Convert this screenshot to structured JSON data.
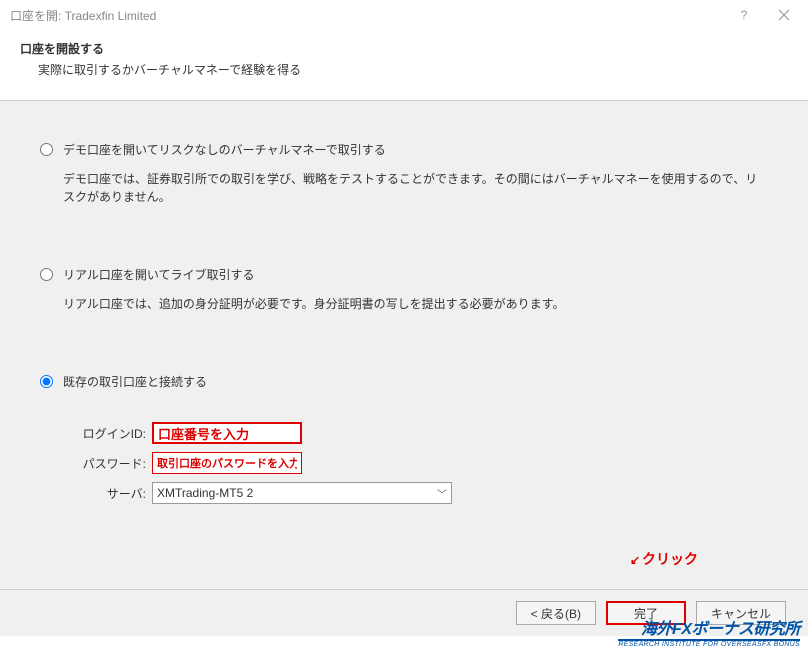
{
  "window": {
    "title": "口座を開: Tradexfin Limited"
  },
  "header": {
    "title": "口座を開設する",
    "subtitle": "実際に取引するかバーチャルマネーで経験を得る"
  },
  "options": {
    "demo": {
      "title": "デモ口座を開いてリスクなしのバーチャルマネーで取引する",
      "desc": "デモ口座では、証券取引所での取引を学び、戦略をテストすることができます。その間にはバーチャルマネーを使用するので、リスクがありません。"
    },
    "real": {
      "title": "リアル口座を開いてライブ取引する",
      "desc": "リアル口座では、追加の身分証明が必要です。身分証明書の写しを提出する必要があります。"
    },
    "existing": {
      "title": "既存の取引口座と接続する"
    }
  },
  "form": {
    "login_label": "ログインID:",
    "login_value": "口座番号を入力",
    "password_label": "パスワード:",
    "password_value": "取引口座のパスワードを入力",
    "server_label": "サーバ:",
    "server_value": "XMTrading-MT5 2"
  },
  "footer": {
    "back": "< 戻る(B)",
    "finish": "完了",
    "cancel": "キャンセル"
  },
  "annotations": {
    "click": "クリック"
  },
  "watermark": {
    "main": "海外FXボーナス研究所",
    "sub": "RESEARCH INSTITUTE FOR OVERSEASFX BONUS"
  }
}
